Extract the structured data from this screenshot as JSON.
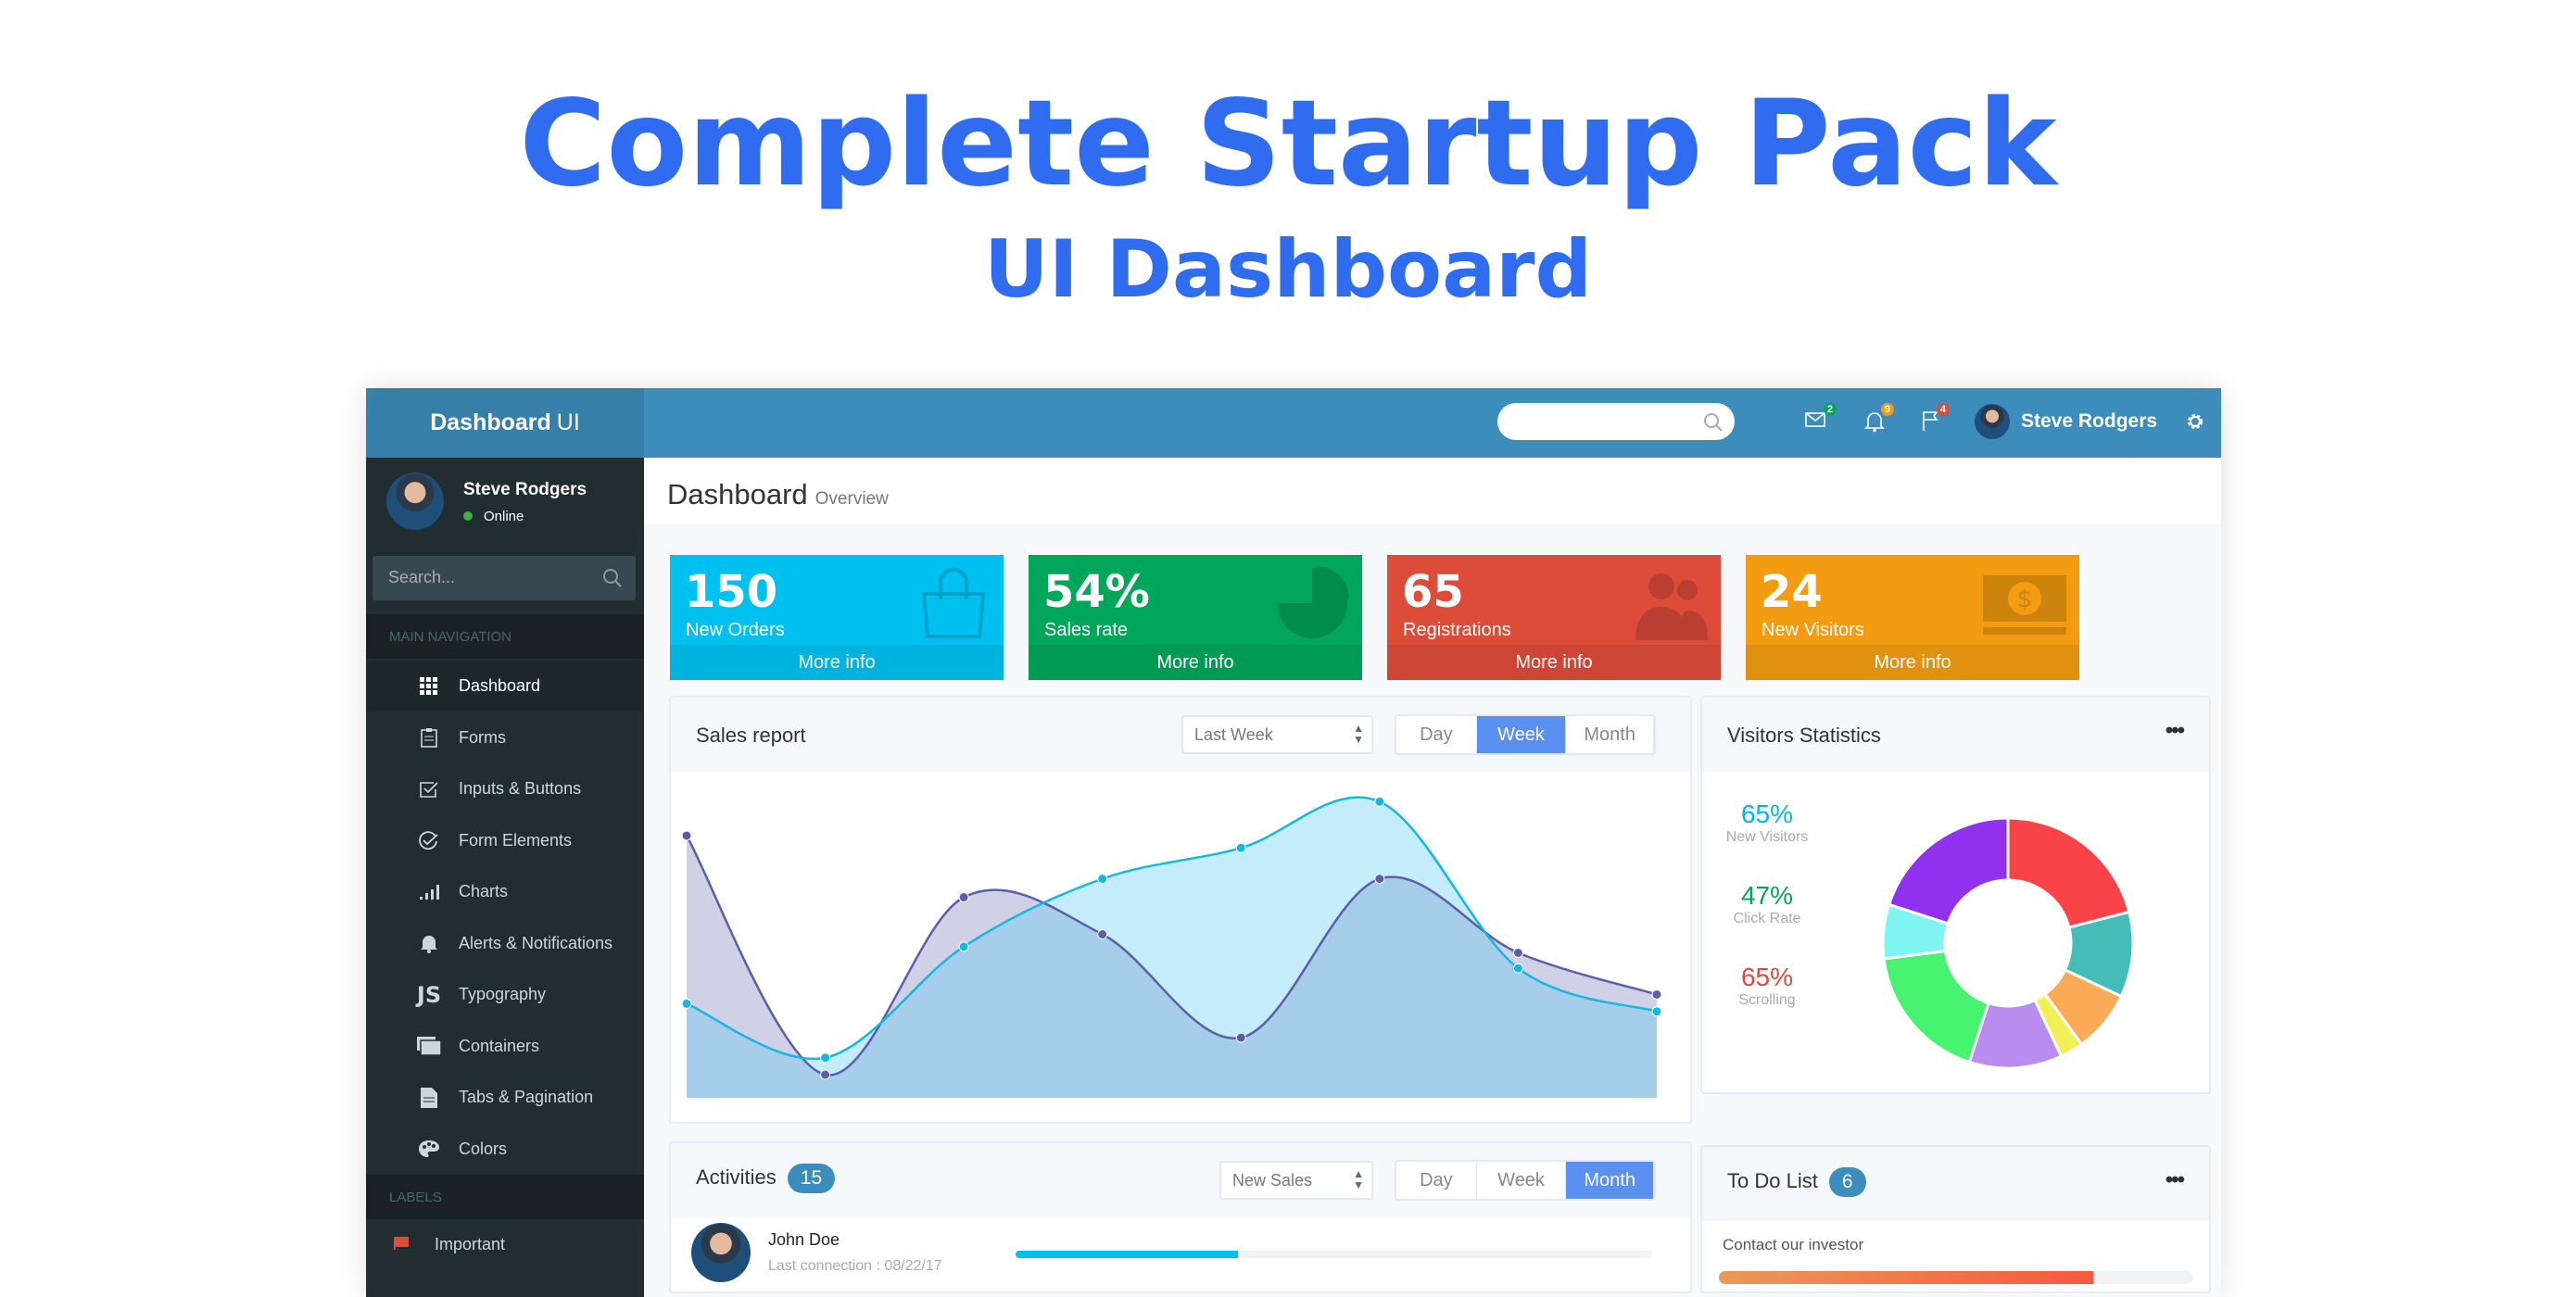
{
  "hero": {
    "title": "Complete Startup Pack",
    "subtitle": "UI Dashboard"
  },
  "colors": {
    "accent": "#2f6cf0",
    "topbar": "#3c8dbc",
    "sidebar": "#222d32",
    "active_tab": "#5b8ff0"
  },
  "topbar": {
    "logo_bold": "Dashboard",
    "logo_light": "UI",
    "search_placeholder": "",
    "user": "Steve Rodgers",
    "badges": {
      "mail": "2",
      "bell": "9",
      "flag": "4"
    }
  },
  "sidebar": {
    "user": "Steve Rodgers",
    "status": "Online",
    "search_placeholder": "Search...",
    "main_header": "MAIN NAVIGATION",
    "items": [
      {
        "label": "Dashboard",
        "icon": "grid-icon"
      },
      {
        "label": "Forms",
        "icon": "clipboard-icon"
      },
      {
        "label": "Inputs & Buttons",
        "icon": "checkbox-icon"
      },
      {
        "label": "Form Elements",
        "icon": "check-circle-icon"
      },
      {
        "label": "Charts",
        "icon": "bar-chart-icon"
      },
      {
        "label": "Alerts & Notifications",
        "icon": "bell-icon"
      },
      {
        "label": "Typography",
        "icon": "js-icon"
      },
      {
        "label": "Containers",
        "icon": "containers-icon"
      },
      {
        "label": "Tabs & Pagination",
        "icon": "document-icon"
      },
      {
        "label": "Colors",
        "icon": "palette-icon"
      }
    ],
    "labels_header": "LABELS",
    "labels": [
      {
        "label": "Important",
        "color": "#dd4b39"
      }
    ]
  },
  "page": {
    "title": "Dashboard",
    "subtitle": "Overview"
  },
  "cards": [
    {
      "value": "150",
      "label": "New Orders",
      "more": "More info",
      "color": "#00c0ef",
      "icon": "shopping-bag-icon"
    },
    {
      "value": "54%",
      "label": "Sales rate",
      "more": "More info",
      "color": "#00a65a",
      "icon": "pie-chart-icon"
    },
    {
      "value": "65",
      "label": "Registrations",
      "more": "More info",
      "color": "#dd4b39",
      "icon": "users-icon"
    },
    {
      "value": "24",
      "label": "New Visitors",
      "more": "More info",
      "color": "#f39c12",
      "icon": "money-icon"
    }
  ],
  "sales": {
    "title": "Sales report",
    "select": "Last Week",
    "tabs": [
      "Day",
      "Week",
      "Month"
    ],
    "active": "Week"
  },
  "visitors": {
    "title": "Visitors Statistics",
    "stats": [
      {
        "value": "65%",
        "label": "New Visitors",
        "color": "#00b7e8"
      },
      {
        "value": "47%",
        "label": "Click Rate",
        "color": "#00a65a"
      },
      {
        "value": "65%",
        "label": "Scrolling",
        "color": "#dd4b39"
      }
    ]
  },
  "activities": {
    "title": "Activities",
    "count": "15",
    "select": "New Sales",
    "tabs": [
      "Day",
      "Week",
      "Month"
    ],
    "active": "Month",
    "rows": [
      {
        "name": "John Doe",
        "sub": "Last connection : 08/22/17",
        "progress": 35
      }
    ]
  },
  "todo": {
    "title": "To Do List",
    "count": "6",
    "items": [
      {
        "label": "Contact our investor",
        "progress": 79
      }
    ]
  },
  "chart_data": [
    {
      "type": "area",
      "title": "Sales report",
      "x": [
        1,
        2,
        3,
        4,
        5,
        6,
        7,
        8
      ],
      "series": [
        {
          "values": [
            85,
            7.5,
            65,
            53,
            19.5,
            71,
            47,
            33.5
          ],
          "color": "#5a5fa8"
        },
        {
          "values": [
            30.5,
            13,
            49,
            71,
            81,
            96,
            42,
            28
          ],
          "color": "#15b8e0"
        }
      ],
      "ylim": [
        0,
        100
      ],
      "grid": false
    },
    {
      "type": "pie",
      "donut": true,
      "title": "Visitors Statistics",
      "values": [
        21,
        11,
        8,
        3,
        12,
        18,
        7,
        20
      ],
      "colors": [
        "#f84349",
        "#44bdb8",
        "#fbab55",
        "#f2f057",
        "#b98cf0",
        "#46f26f",
        "#7ff4f1",
        "#9230f0"
      ]
    }
  ]
}
